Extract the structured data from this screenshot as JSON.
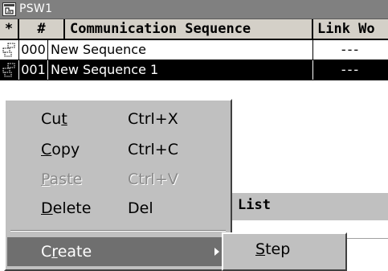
{
  "window": {
    "title": "PSW1",
    "icon": "app-window-icon"
  },
  "grid": {
    "columns": [
      "*",
      "#",
      "Communication Sequence",
      "Link Wo"
    ],
    "rows": [
      {
        "icon": "sequence-icon",
        "number": "000",
        "name": "New Sequence",
        "link": "---"
      },
      {
        "icon": "sequence-icon",
        "number": "001",
        "name": "New Sequence 1",
        "link": "---",
        "selected": true
      }
    ]
  },
  "panel": {
    "label": "List"
  },
  "context_menu": {
    "items": [
      {
        "label_pre": "Cu",
        "label_key": "t",
        "label_post": "",
        "shortcut": "Ctrl+X",
        "enabled": true
      },
      {
        "label_pre": "",
        "label_key": "C",
        "label_post": "opy",
        "shortcut": "Ctrl+C",
        "enabled": true
      },
      {
        "label_pre": "",
        "label_key": "P",
        "label_post": "aste",
        "shortcut": "Ctrl+V",
        "enabled": false
      },
      {
        "label_pre": "",
        "label_key": "D",
        "label_post": "elete",
        "shortcut": "Del",
        "enabled": true
      }
    ],
    "create": {
      "label_pre": "C",
      "label_key": "r",
      "label_post": "eate",
      "highlighted": true
    }
  },
  "submenu": {
    "items": [
      {
        "label_pre": "",
        "label_key": "S",
        "label_post": "tep"
      }
    ]
  },
  "colors": {
    "title_bar": "#808080",
    "menu_bg": "#c0c0c0",
    "highlight": "#6f6f6f",
    "selected_row": "#000000"
  }
}
